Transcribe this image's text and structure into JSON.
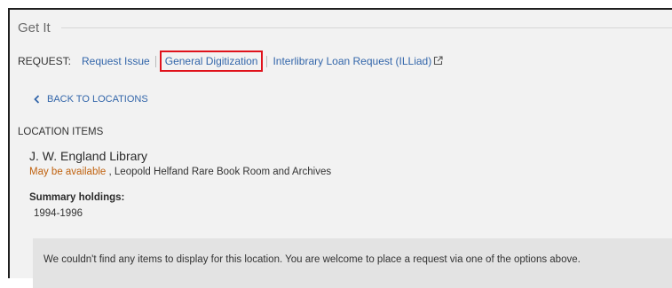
{
  "section": {
    "title": "Get It"
  },
  "request": {
    "label": "REQUEST:",
    "options": [
      {
        "label": "Request Issue"
      },
      {
        "label": "General Digitization",
        "highlighted": true
      },
      {
        "label": "Interlibrary Loan Request (ILLiad)",
        "external": true
      }
    ]
  },
  "navigation": {
    "back_label": "BACK TO LOCATIONS",
    "back_icon": "chevron-left-icon"
  },
  "location_items": {
    "heading": "LOCATION ITEMS",
    "library_name": "J. W. England Library",
    "availability_status": "May be available",
    "availability_location": " , Leopold Helfand Rare Book Room and Archives",
    "summary_label": "Summary holdings:",
    "summary_value": "1994-1996",
    "notice": "We couldn't find any items to display for this location. You are welcome to place a request via one of the options above."
  },
  "colors": {
    "link": "#3366aa",
    "availability": "#c0620f",
    "highlight_outline": "#e0121b",
    "panel_background": "#f2f2f2",
    "notice_background": "#e3e3e3"
  }
}
